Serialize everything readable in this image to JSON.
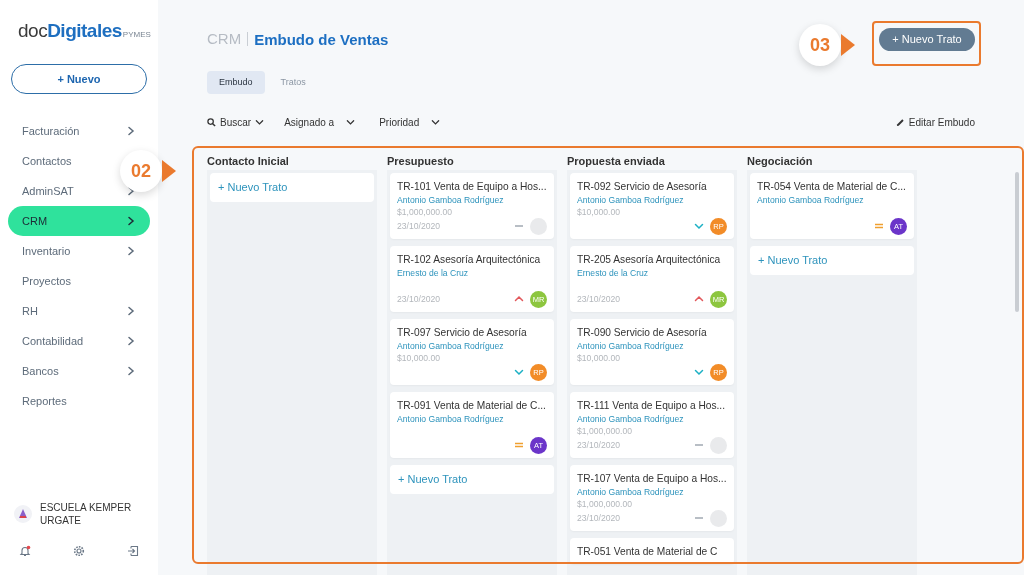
{
  "sidebar": {
    "logo": {
      "main": "doc**Digitales**",
      "suffix": "PYMES"
    },
    "new_button": "+ Nuevo",
    "items": [
      {
        "label": "Facturación",
        "has_submenu": true,
        "selected": false
      },
      {
        "label": "Contactos",
        "has_submenu": false,
        "selected": false
      },
      {
        "label": "AdminSAT",
        "has_submenu": true,
        "selected": false
      },
      {
        "label": "CRM",
        "has_submenu": true,
        "selected": true
      },
      {
        "label": "Inventario",
        "has_submenu": true,
        "selected": false
      },
      {
        "label": "Proyectos",
        "has_submenu": false,
        "selected": false
      },
      {
        "label": "RH",
        "has_submenu": true,
        "selected": false
      },
      {
        "label": "Contabilidad",
        "has_submenu": true,
        "selected": false
      },
      {
        "label": "Bancos",
        "has_submenu": true,
        "selected": false
      },
      {
        "label": "Reportes",
        "has_submenu": false,
        "selected": false
      }
    ],
    "account": "ESCUELA KEMPER URGATE",
    "notifications": true
  },
  "header": {
    "section": "CRM",
    "title": "Embudo de Ventas",
    "new_button": "+ Nuevo Trato"
  },
  "tabs": [
    {
      "label": "Embudo",
      "selected": true
    },
    {
      "label": "Tratos",
      "selected": false
    }
  ],
  "filters": [
    {
      "label": "Buscar",
      "kind": "search"
    },
    {
      "label": "Asignado a",
      "kind": "dropdown"
    },
    {
      "label": "Prioridad",
      "kind": "dropdown"
    }
  ],
  "edit_button": "Editar Embudo",
  "columns": [
    {
      "title": "Contacto Inicial",
      "add_label": "+ Nuevo Trato"
    },
    {
      "title": "Presupuesto",
      "add_label": "+ Nuevo Trato",
      "cards": [
        {
          "title": "TR-101 Venta de Equipo a Hos...",
          "client": "Antonio Gamboa Rodríguez",
          "amount": "$1,000,000.00",
          "date": "23/10/2020",
          "priority": {
            "kind": "none"
          },
          "avatar": {
            "color": "#e9eaec"
          }
        },
        {
          "title": "TR-102 Asesoría Arquitectónica",
          "client": "Ernesto de la Cruz",
          "date": "23/10/2020",
          "priority": {
            "kind": "high"
          },
          "avatar": {
            "initials": "MR",
            "color": "#8dc63f"
          }
        },
        {
          "title": "TR-097 Servicio de Asesoría",
          "client": "Antonio Gamboa Rodríguez",
          "amount": "$10,000.00",
          "priority": {
            "kind": "low"
          },
          "avatar": {
            "initials": "RP",
            "color": "#f28c28"
          }
        },
        {
          "title": "TR-091 Venta de Material de C...",
          "client": "Antonio Gamboa Rodríguez",
          "priority": {
            "kind": "medium"
          },
          "avatar": {
            "initials": "AT",
            "color": "#6b35c9"
          }
        }
      ]
    },
    {
      "title": "Propuesta enviada",
      "cards": [
        {
          "title": "TR-092 Servicio de Asesoría",
          "client": "Antonio Gamboa Rodríguez",
          "amount": "$10,000.00",
          "priority": {
            "kind": "low"
          },
          "avatar": {
            "initials": "RP",
            "color": "#f28c28"
          }
        },
        {
          "title": "TR-205 Asesoría Arquitectónica",
          "client": "Ernesto de la Cruz",
          "date": "23/10/2020",
          "priority": {
            "kind": "high"
          },
          "avatar": {
            "initials": "MR",
            "color": "#8dc63f"
          }
        },
        {
          "title": "TR-090 Servicio de Asesoría",
          "client": "Antonio Gamboa Rodríguez",
          "amount": "$10,000.00",
          "priority": {
            "kind": "low"
          },
          "avatar": {
            "initials": "RP",
            "color": "#f28c28"
          }
        },
        {
          "title": "TR-111 Venta de Equipo a Hos...",
          "client": "Antonio Gamboa Rodríguez",
          "amount": "$1,000,000.00",
          "date": "23/10/2020",
          "priority": {
            "kind": "none"
          },
          "avatar": {
            "color": "#e9eaec"
          }
        },
        {
          "title": "TR-107 Venta de Equipo a Hos...",
          "client": "Antonio Gamboa Rodríguez",
          "amount": "$1,000,000.00",
          "date": "23/10/2020",
          "priority": {
            "kind": "none"
          },
          "avatar": {
            "color": "#e9eaec"
          }
        },
        {
          "title": "TR-051 Venta de Material de C"
        }
      ]
    },
    {
      "title": "Negociación",
      "add_label": "+ Nuevo Trato",
      "cards": [
        {
          "title": "TR-054 Venta de Material de C...",
          "client": "Antonio Gamboa Rodríguez",
          "priority": {
            "kind": "medium"
          },
          "avatar": {
            "initials": "AT",
            "color": "#6b35c9"
          }
        }
      ]
    }
  ],
  "callouts": [
    {
      "label": "02"
    },
    {
      "label": "03"
    }
  ]
}
